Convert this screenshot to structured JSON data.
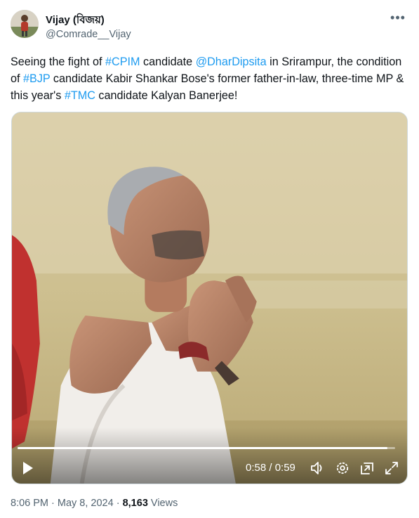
{
  "author": {
    "display_name": "Vijay (বিজয়)",
    "handle": "@Comrade__Vijay",
    "avatar_icon": "profile-photo"
  },
  "more_icon": "ellipsis-icon",
  "tweet": {
    "parts": [
      {
        "text": "Seeing the fight of ",
        "link": false
      },
      {
        "text": "#CPIM",
        "link": true
      },
      {
        "text": " candidate ",
        "link": false
      },
      {
        "text": "@DharDipsita",
        "link": true
      },
      {
        "text": " in Srirampur, the condition of ",
        "link": false
      },
      {
        "text": "#BJP",
        "link": true
      },
      {
        "text": " candidate Kabir Shankar Bose's former father-in-law, three-time MP & this year's ",
        "link": false
      },
      {
        "text": "#TMC",
        "link": true
      },
      {
        "text": " candidate Kalyan Banerjee!",
        "link": false
      }
    ]
  },
  "video": {
    "time_display": "0:58 / 0:59",
    "progress": 0.98,
    "icons": [
      "play-icon",
      "volume-icon",
      "settings-icon",
      "picture-in-picture-icon",
      "fullscreen-icon"
    ]
  },
  "meta": {
    "time": "8:06 PM",
    "sep1": " · ",
    "date": "May 8, 2024",
    "sep2": " · ",
    "views_count": "8,163",
    "views_label": " Views"
  },
  "colors": {
    "link": "#1d9bf0",
    "text": "#0f1419",
    "secondary": "#536471"
  }
}
